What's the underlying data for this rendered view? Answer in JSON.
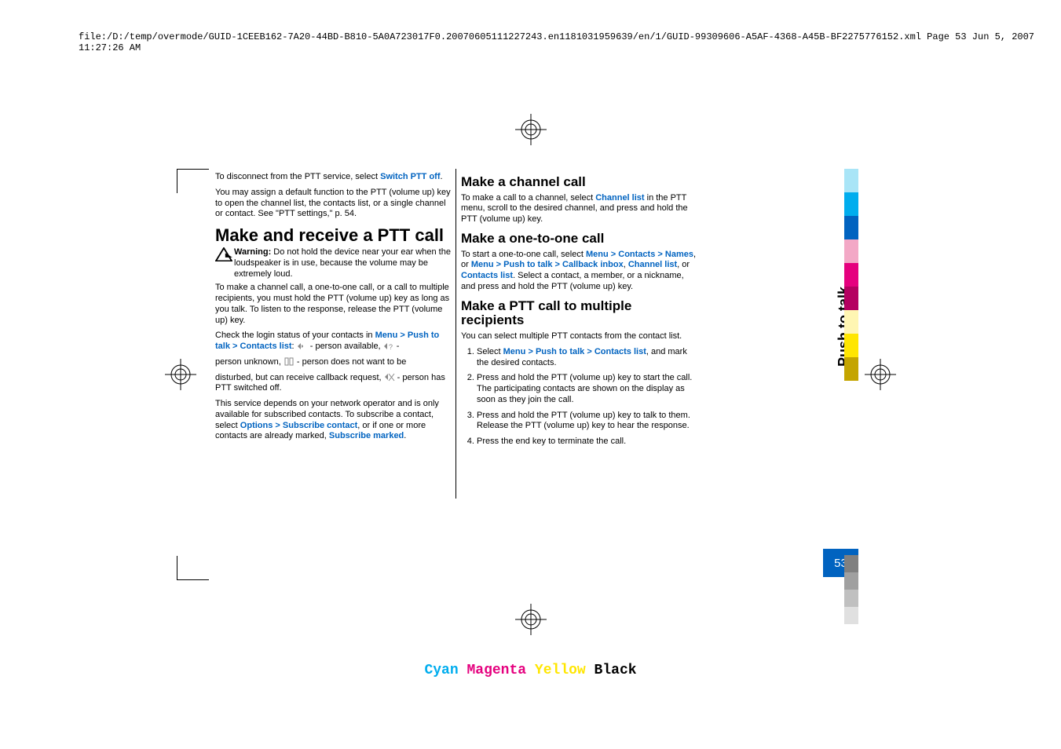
{
  "topPath": "file:/D:/temp/overmode/GUID-1CEEB162-7A20-44BD-B810-5A0A723017F0.20070605111227243.en1181031959639/en/1/GUID-99309606-A5AF-4368-A45B-BF2275776152.xml    Page 53    Jun 5, 2007 11:27:26 AM",
  "col1": {
    "p1a": "To disconnect from the PTT service, select ",
    "p1b": "Switch PTT off",
    "p2": "You may assign a default function to the PTT (volume up) key to open the channel list, the contacts list, or a single channel or contact. See \"PTT settings,\" p. 54.",
    "h1": "Make and receive a PTT call",
    "warnLabel": "Warning:",
    "warnText": "  Do not hold the device near your ear when the loudspeaker is in use, because the volume may be extremely loud.",
    "p3": "To make a channel call, a one-to-one call, or a call to multiple recipients, you must hold the PTT (volume up) key as long as you talk. To listen to the response, release the PTT (volume up) key.",
    "p4a": "Check the login status of your contacts in ",
    "menu": "Menu",
    "arrow": ">",
    "push": "Push to talk",
    "contacts": "Contacts list",
    "p4b": ": ",
    "avail": " - person available, ",
    "unk": " - ",
    "p5": "person unknown, ",
    "p5b": " - person does not want to be",
    "p6": "disturbed, but can receive callback request, ",
    "p6b": " - person has PTT switched off.",
    "p7a": "This service depends on your network operator and is only available for subscribed contacts. To subscribe a contact, select ",
    "options": "Options",
    "subc": "Subscribe contact",
    "p7b": ", or if one or more contacts are already marked, ",
    "subm": "Subscribe marked"
  },
  "col2": {
    "h1": "Make a channel call",
    "p1a": "To make a call to a channel, select ",
    "chlist": "Channel list",
    "p1b": " in the PTT menu, scroll to the desired channel, and press and hold the PTT (volume up) key.",
    "h2": "Make a one-to-one call",
    "p2a": "To start a one-to-one call, select ",
    "menu": "Menu",
    "arrow": ">",
    "contacts": "Contacts",
    "names": "Names",
    "or": ", or ",
    "push": "Push to talk",
    "cb": "Callback inbox",
    "chl": "Channel list",
    "or2": ", or ",
    "cl": "Contacts list",
    "p2b": ". Select a contact, a member, or a nickname, and press and hold the PTT (volume up) key.",
    "h3": "Make a PTT call to multiple recipients",
    "p3": "You can select multiple PTT contacts from the contact list.",
    "li1a": "Select ",
    "li1b": ", and mark the desired contacts.",
    "li2": "Press and hold the PTT (volume up) key to start the call. The participating contacts are shown on the display as soon as they join the call.",
    "li3": "Press and hold the PTT (volume up) key to talk to them. Release the PTT (volume up) key to hear the response.",
    "li4": "Press the end key to terminate the call."
  },
  "sideLabel": "Push to talk",
  "pageNum": "53",
  "cmyk": {
    "c": "Cyan",
    "m": "Magenta",
    "y": "Yellow",
    "k": "Black"
  },
  "sideColors": [
    "#a9e5f7",
    "#00adee",
    "#0163c0",
    "#f3a8c6",
    "#e5007e",
    "#b40060",
    "#fff6b3",
    "#ffe600",
    "#c4a500"
  ],
  "grays": [
    "#808080",
    "#a0a0a0",
    "#c0c0c0",
    "#e0e0e0"
  ]
}
